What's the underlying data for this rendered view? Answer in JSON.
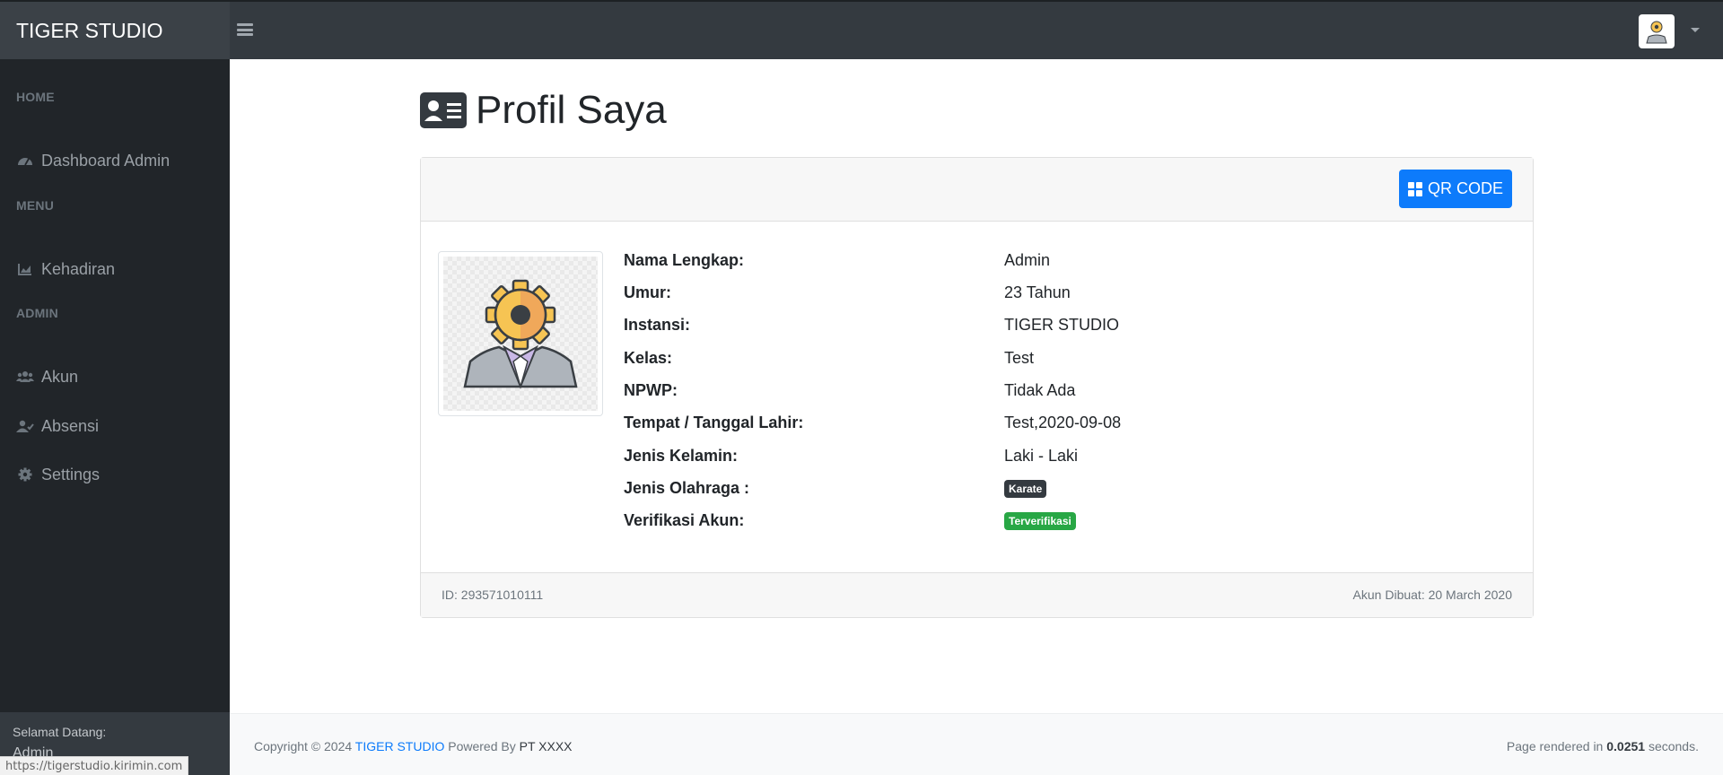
{
  "brand": {
    "name": "TIGER STUDIO"
  },
  "sidebar": {
    "sections": [
      {
        "heading": "HOME",
        "items": [
          {
            "label": "Dashboard Admin",
            "icon": "dashboard-gauge-icon"
          }
        ]
      },
      {
        "heading": "MENU",
        "items": [
          {
            "label": "Kehadiran",
            "icon": "area-chart-icon"
          }
        ]
      },
      {
        "heading": "ADMIN",
        "items": [
          {
            "label": "Akun",
            "icon": "users-icon"
          },
          {
            "label": "Absensi",
            "icon": "user-check-icon"
          },
          {
            "label": "Settings",
            "icon": "gear-icon"
          }
        ]
      }
    ],
    "footer": {
      "welcome": "Selamat Datang:",
      "user": "Admin"
    }
  },
  "status_url": "https://tigerstudio.kirimin.com",
  "main": {
    "title": "Profil Saya",
    "title_icon": "id-card-icon",
    "qr_button": "QR CODE",
    "profile": [
      {
        "label": "Nama Lengkap:",
        "value": "Admin"
      },
      {
        "label": "Umur:",
        "value": "23 Tahun"
      },
      {
        "label": "Instansi:",
        "value": "TIGER STUDIO"
      },
      {
        "label": "Kelas:",
        "value": "Test"
      },
      {
        "label": "NPWP:",
        "value": "Tidak Ada"
      },
      {
        "label": "Tempat / Tanggal Lahir:",
        "value": "Test,2020-09-08"
      },
      {
        "label": "Jenis Kelamin:",
        "value": "Laki - Laki"
      },
      {
        "label": "Jenis Olahraga :",
        "badge": "Karate",
        "badge_color": "#343a40"
      },
      {
        "label": "Verifikasi Akun:",
        "badge": "Terverifikasi",
        "badge_color": "#28a745"
      }
    ],
    "card_footer": {
      "id": "ID: 293571010111",
      "created": "Akun Dibuat: 20 March 2020"
    }
  },
  "footer": {
    "copyright": "Copyright © 2024",
    "company_link": "TIGER STUDIO",
    "powered_by": "Powered By",
    "powered_company": "PT XXXX",
    "render_prefix": "Page rendered in",
    "render_time": "0.0251",
    "render_suffix": "seconds."
  },
  "colors": {
    "primary": "#0d7bfb",
    "sidebar": "#212529",
    "topbar": "#343a40",
    "success": "#28a745"
  }
}
